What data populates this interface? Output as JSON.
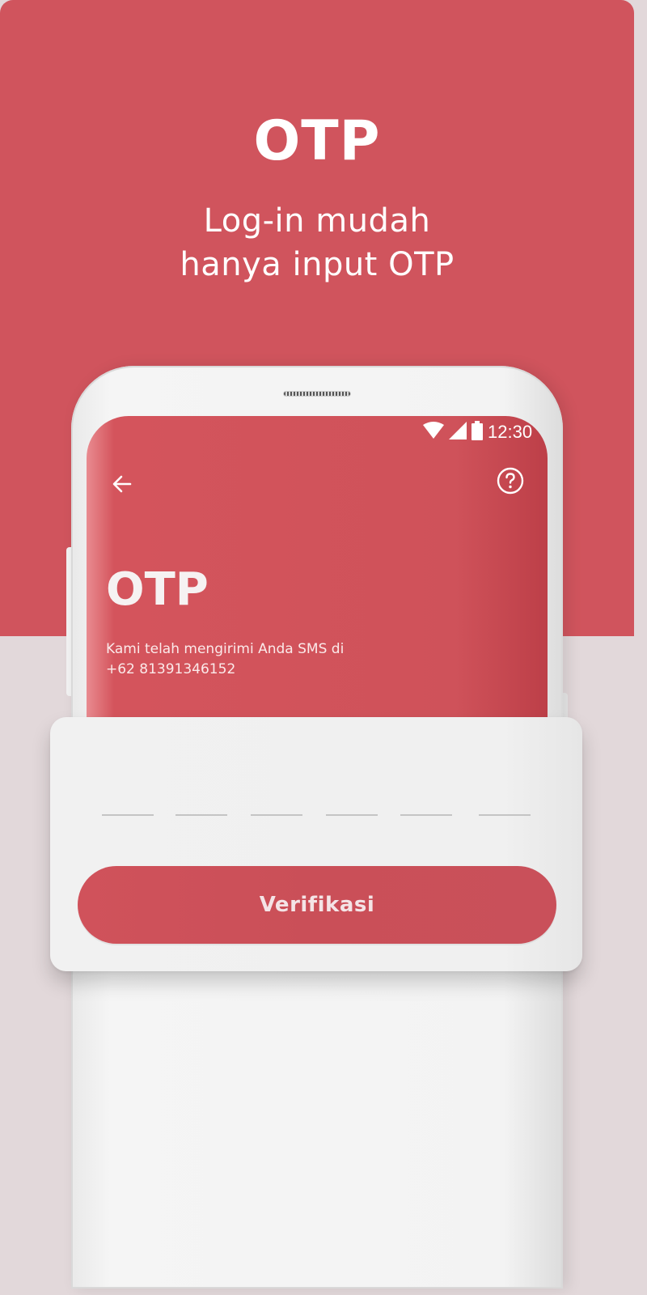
{
  "banner": {
    "headline": "OTP",
    "subline_1": "Log-in mudah",
    "subline_2": "hanya input OTP"
  },
  "status_bar": {
    "time": "12:30",
    "icons": [
      "wifi-icon",
      "signal-icon",
      "battery-icon"
    ]
  },
  "screen": {
    "back_icon": "arrow-left-icon",
    "help_icon": "question-circle-icon",
    "title": "OTP",
    "desc_line_1": "Kami telah mengirimi Anda SMS di",
    "desc_line_2": "+62 81391346152"
  },
  "otp": {
    "slots": [
      "",
      "",
      "",
      "",
      "",
      ""
    ]
  },
  "actions": {
    "verify_label": "Verifikasi"
  },
  "colors": {
    "brand": "#d0545d",
    "background_lower": "#e2d8da",
    "card": "#f0f0f0"
  }
}
